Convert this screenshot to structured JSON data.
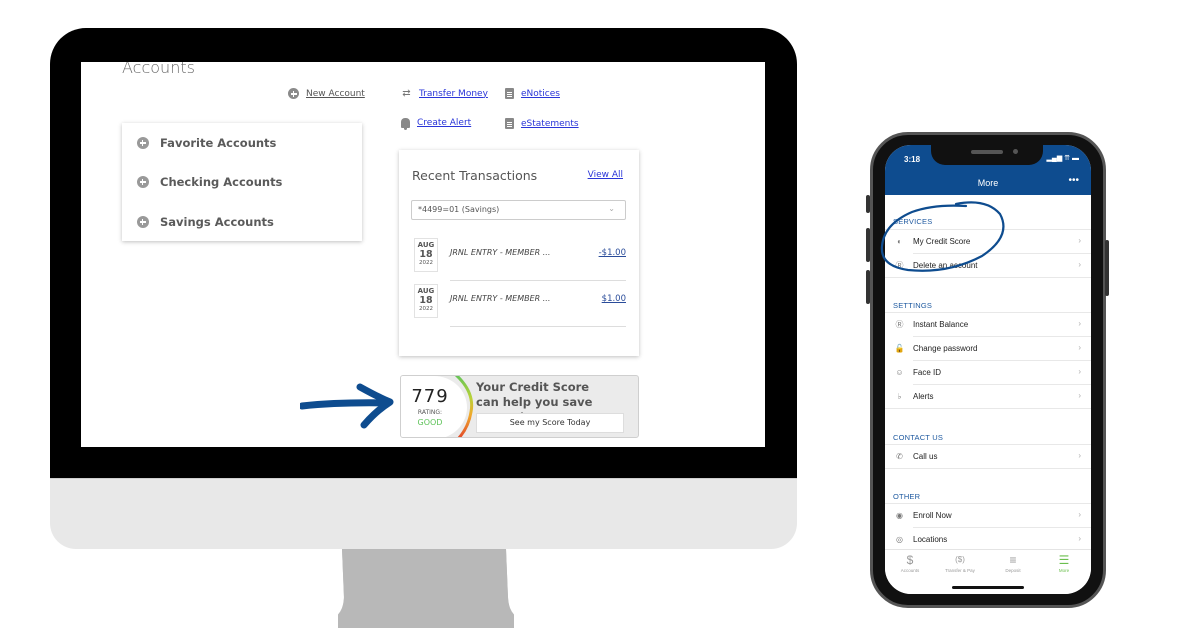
{
  "desktop": {
    "page_title": "Accounts",
    "new_account_label": "New Account",
    "quick_links": [
      {
        "label": "Transfer Money",
        "icon": "transfer-icon"
      },
      {
        "label": "eNotices",
        "icon": "document-icon"
      },
      {
        "label": "Create Alert",
        "icon": "bell-icon"
      },
      {
        "label": "eStatements",
        "icon": "document-icon"
      }
    ],
    "account_groups": [
      {
        "label": "Favorite Accounts"
      },
      {
        "label": "Checking Accounts"
      },
      {
        "label": "Savings Accounts"
      }
    ],
    "recent_transactions": {
      "title": "Recent Transactions",
      "view_all_label": "View All",
      "selected_account": "*4499=01 (Savings)",
      "items": [
        {
          "month": "AUG",
          "day": "18",
          "year": "2022",
          "description": "JRNL ENTRY - MEMBER ...",
          "amount": "-$1.00"
        },
        {
          "month": "AUG",
          "day": "18",
          "year": "2022",
          "description": "JRNL ENTRY - MEMBER ...",
          "amount": "$1.00"
        }
      ]
    },
    "credit_banner": {
      "score": "779",
      "rating_label": "RATING:",
      "rating_value": "GOOD",
      "headline_line1": "Your Credit Score",
      "headline_line2": "can help you save money!",
      "button_label": "See my Score Today",
      "rating_color": "#5fc35a"
    }
  },
  "phone": {
    "status_time": "3:18",
    "status_icons": "▂▄▆ ▲ ▬",
    "header_title": "More",
    "header_menu": "•••",
    "brand_color": "#0e4c8f",
    "sections": [
      {
        "title": "SERVICES",
        "items": [
          {
            "label": "My Credit Score",
            "icon": "speedometer-icon"
          },
          {
            "label": "Delete an account",
            "icon": "dollar-circle-icon"
          }
        ]
      },
      {
        "title": "SETTINGS",
        "items": [
          {
            "label": "Instant Balance",
            "icon": "instant-balance-icon"
          },
          {
            "label": "Change password",
            "icon": "lock-icon"
          },
          {
            "label": "Face ID",
            "icon": "face-id-icon"
          },
          {
            "label": "Alerts",
            "icon": "bell-icon"
          }
        ]
      },
      {
        "title": "CONTACT US",
        "items": [
          {
            "label": "Call us",
            "icon": "phone-icon"
          }
        ]
      },
      {
        "title": "OTHER",
        "items": [
          {
            "label": "Enroll Now",
            "icon": "enroll-icon"
          },
          {
            "label": "Locations",
            "icon": "location-icon"
          }
        ]
      }
    ],
    "tabs": [
      {
        "label": "Accounts",
        "icon": "$",
        "active": false
      },
      {
        "label": "Transfer & Pay",
        "icon": "($)",
        "active": false
      },
      {
        "label": "Deposit",
        "icon": "≡",
        "active": false
      },
      {
        "label": "More",
        "icon": "☰",
        "active": true
      }
    ],
    "active_tab_color": "#6bbf4e"
  },
  "annotation_color": "#0e4c8f"
}
